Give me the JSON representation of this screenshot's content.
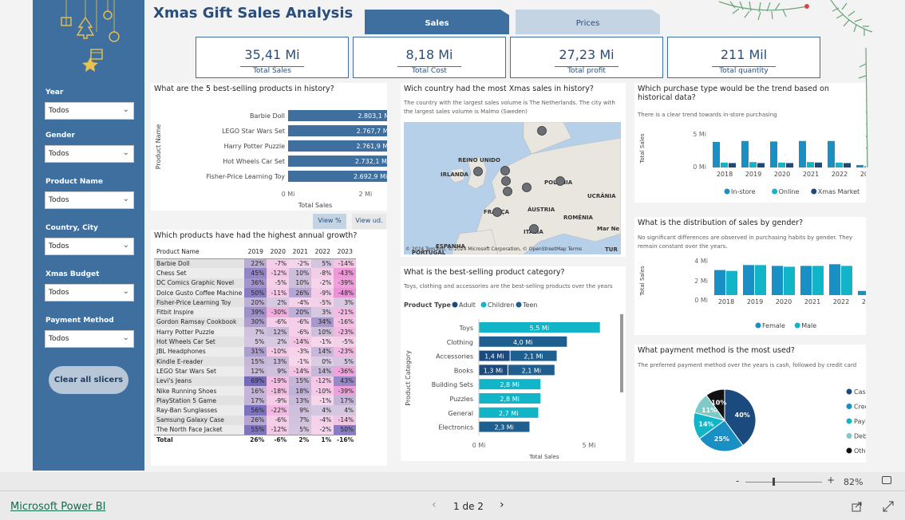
{
  "title": "Xmas Gift Sales Analysis",
  "tabs": [
    {
      "label": "Sales"
    },
    {
      "label": "Prices"
    }
  ],
  "kpis": [
    {
      "value": "35,41 Mi",
      "label": "Total Sales"
    },
    {
      "value": "8,18 Mi",
      "label": "Total Cost"
    },
    {
      "value": "27,23 Mi",
      "label": "Total profit"
    },
    {
      "value": "211 Mil",
      "label": "Total quantity"
    }
  ],
  "slicers": [
    {
      "label": "Year",
      "value": "Todos"
    },
    {
      "label": "Gender",
      "value": "Todos"
    },
    {
      "label": "Product Name",
      "value": "Todos"
    },
    {
      "label": "Country, City",
      "value": "Todos"
    },
    {
      "label": "Xmas Budget",
      "value": "Todos"
    },
    {
      "label": "Payment Method",
      "value": "Todos"
    }
  ],
  "clear_button": "Clear all slicers",
  "colors": {
    "dark_blue": "#3e6f9f",
    "navy": "#1a4a7e",
    "teal": "#12b5c8",
    "light_teal": "#7fcac7",
    "accent": "#2a4e7c"
  },
  "top_products": {
    "title": "What are the 5 best-selling products in history?",
    "ylabel": "Product Name",
    "xlabel": "Total Sales",
    "ticks": [
      "0 Mi",
      "2 Mi"
    ],
    "btn_pct": "View %",
    "btn_ud": "View ud.",
    "chart_data": {
      "type": "bar",
      "categories": [
        "Barbie Doll",
        "LEGO Star Wars Set",
        "Harry Potter Puzzle",
        "Hot Wheels Car Set",
        "Fisher-Price Learning Toy"
      ],
      "values": [
        2.8031,
        2.7677,
        2.7619,
        2.7321,
        2.6929
      ],
      "labels": [
        "2.803,1 Mil",
        "2.767,7 Mil",
        "2.761,9 Mil",
        "2.732,1 Mil",
        "2.692,9 Mil"
      ],
      "xlim": [
        0,
        3.2
      ]
    }
  },
  "growth": {
    "title": "Which products have had the highest annual growth?",
    "headers": [
      "Product Name",
      "2019",
      "2020",
      "2021",
      "2022",
      "2023"
    ],
    "rows": [
      [
        "Barbie Doll",
        "22%",
        "-7%",
        "-2%",
        "5%",
        "-14%"
      ],
      [
        "Chess Set",
        "45%",
        "-12%",
        "10%",
        "-8%",
        "-43%"
      ],
      [
        "DC Comics Graphic Novel",
        "36%",
        "-5%",
        "10%",
        "-2%",
        "-39%"
      ],
      [
        "Dolce Gusto Coffee Machine",
        "50%",
        "-11%",
        "26%",
        "-9%",
        "-48%"
      ],
      [
        "Fisher-Price Learning Toy",
        "20%",
        "2%",
        "-4%",
        "-5%",
        "3%"
      ],
      [
        "Fitbit Inspire",
        "39%",
        "-30%",
        "20%",
        "3%",
        "-21%"
      ],
      [
        "Gordon Ramsay Cookbook",
        "30%",
        "-6%",
        "-6%",
        "34%",
        "-16%"
      ],
      [
        "Harry Potter Puzzle",
        "7%",
        "12%",
        "-6%",
        "10%",
        "-23%"
      ],
      [
        "Hot Wheels Car Set",
        "5%",
        "2%",
        "-14%",
        "-1%",
        "-5%"
      ],
      [
        "JBL Headphones",
        "31%",
        "-10%",
        "-3%",
        "14%",
        "-23%"
      ],
      [
        "Kindle E-reader",
        "15%",
        "13%",
        "-1%",
        "0%",
        "5%"
      ],
      [
        "LEGO Star Wars Set",
        "12%",
        "9%",
        "-14%",
        "14%",
        "-36%"
      ],
      [
        "Levi's Jeans",
        "69%",
        "-19%",
        "15%",
        "-12%",
        "43%"
      ],
      [
        "Nike Running Shoes",
        "16%",
        "-18%",
        "18%",
        "-10%",
        "-39%"
      ],
      [
        "PlayStation 5 Game",
        "17%",
        "-9%",
        "13%",
        "-1%",
        "17%"
      ],
      [
        "Ray-Ban Sunglasses",
        "56%",
        "-22%",
        "9%",
        "4%",
        "4%"
      ],
      [
        "Samsung Galaxy Case",
        "26%",
        "-6%",
        "7%",
        "-4%",
        "-14%"
      ],
      [
        "The North Face Jacket",
        "55%",
        "-12%",
        "5%",
        "-2%",
        "50%"
      ]
    ],
    "total": [
      "Total",
      "26%",
      "-6%",
      "2%",
      "1%",
      "-16%"
    ]
  },
  "map": {
    "title": "Wich country had the most Xmas sales in history?",
    "subtitle": "The country with the largest sales volume is The Netherlands. The city with the largest sales volume is Malmo (Sweden)",
    "labels": [
      "REINO UNIDO",
      "IRLANDA",
      "POLÔNIA",
      "UCRÂNIA",
      "FRANÇA",
      "ÁUSTRIA",
      "ROMÊNIA",
      "ITÁLIA",
      "Mar Ne",
      "ESPANHA",
      "PORTUGAL",
      "TUR"
    ],
    "attribution": "© 2024 TomTom, © 2024 Microsoft Corporation, © OpenStreetMap  Terms"
  },
  "category": {
    "title": "What is the best-selling product category?",
    "subtitle": "Toys, clothing and accessories are the best-selling products over the years",
    "legend_title": "Product Type",
    "ylabel": "Product Category",
    "xlabel": "Total Sales",
    "ticks": [
      "0 Mi",
      "5 Mi"
    ],
    "chart_data": {
      "type": "bar",
      "stacked": true,
      "categories": [
        "Toys",
        "Clothing",
        "Accessories",
        "Books",
        "Building Sets",
        "Puzzles",
        "General",
        "Electronics"
      ],
      "series": [
        {
          "name": "Adult",
          "values": [
            0,
            0,
            1.4,
            1.3,
            0,
            0,
            0,
            0
          ],
          "labels": [
            "",
            "",
            "1,4 Mi",
            "1,3 Mi",
            "",
            "",
            "",
            ""
          ]
        },
        {
          "name": "Children",
          "values": [
            5.5,
            0,
            0,
            0,
            2.8,
            2.8,
            2.7,
            0
          ],
          "labels": [
            "5,5 Mi",
            "",
            "",
            "",
            "2,8 Mi",
            "2,8 Mi",
            "2,7 Mi",
            ""
          ]
        },
        {
          "name": "Teen",
          "values": [
            0,
            4.0,
            2.1,
            2.1,
            0,
            0,
            0,
            2.3
          ],
          "labels": [
            "",
            "4,0 Mi",
            "2,1 Mi",
            "2,1 Mi",
            "",
            "",
            "",
            "2,3 Mi"
          ]
        }
      ],
      "xlim": [
        0,
        5.8
      ]
    }
  },
  "purchase": {
    "title": "Which purchase type would be the trend based on historical data?",
    "subtitle": "There is a clear trend towards in-store purchasing",
    "ylabel": "Total Sales",
    "ticks": [
      "5 Mi",
      "0 Mi"
    ],
    "chart_data": {
      "type": "bar",
      "categories": [
        "2018",
        "2019",
        "2020",
        "2021",
        "2022",
        "2023"
      ],
      "series": [
        {
          "name": "In-store",
          "values": [
            5.2,
            5.4,
            5.3,
            5.4,
            5.4,
            0.5
          ]
        },
        {
          "name": "Online",
          "values": [
            1.0,
            1.1,
            1.0,
            1.1,
            1.0,
            0.3
          ]
        },
        {
          "name": "Xmas Market",
          "values": [
            0.9,
            0.9,
            0.9,
            1.0,
            0.9,
            0.2
          ]
        }
      ],
      "ylim": [
        0,
        6.5
      ]
    }
  },
  "gender": {
    "title": "What is the distribution of sales by gender?",
    "subtitle": "No significant differences are observed in purchasing habits by gender. They remain constant over the years.",
    "ylabel": "Total Sales",
    "ticks": [
      "4 Mi",
      "2 Mi",
      "0 Mi"
    ],
    "chart_data": {
      "type": "bar",
      "categories": [
        "2018",
        "2019",
        "2020",
        "2021",
        "2022",
        "2023"
      ],
      "series": [
        {
          "name": "Female",
          "values": [
            3.0,
            3.6,
            3.5,
            3.5,
            3.7,
            0.5
          ]
        },
        {
          "name": "Male",
          "values": [
            2.9,
            3.6,
            3.4,
            3.5,
            3.5,
            0.7
          ]
        }
      ],
      "ylim": [
        0,
        4.3
      ]
    }
  },
  "payment": {
    "title": "What payment method is the most used?",
    "subtitle": "The preferred payment method over the years is cash, followed by credit card",
    "chart_data": {
      "type": "pie",
      "categories": [
        "Cash",
        "Credit Card",
        "PayPal",
        "Debit Card",
        "Other"
      ],
      "values": [
        40,
        25,
        14,
        11,
        10
      ],
      "labels": [
        "40%",
        "25%",
        "14%",
        "11%",
        "10%"
      ]
    }
  },
  "footer": {
    "zoom": "82%",
    "page": "1 de 2",
    "powerbi": "Microsoft Power BI"
  }
}
